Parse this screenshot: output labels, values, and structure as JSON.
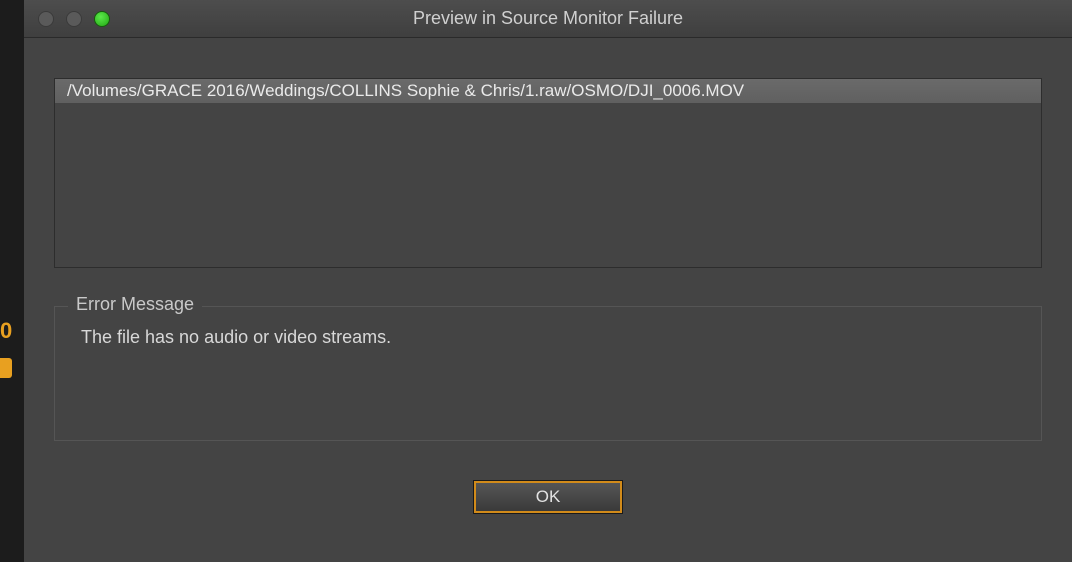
{
  "leftStrip": {
    "accentGlyph": "0"
  },
  "dialog": {
    "title": "Preview in Source Monitor Failure",
    "fileList": {
      "items": [
        {
          "path": "/Volumes/GRACE 2016/Weddings/COLLINS Sophie & Chris/1.raw/OSMO/DJI_0006.MOV"
        }
      ]
    },
    "errorSection": {
      "legend": "Error Message",
      "message": "The file has no audio or video streams."
    },
    "buttons": {
      "ok": "OK"
    }
  }
}
